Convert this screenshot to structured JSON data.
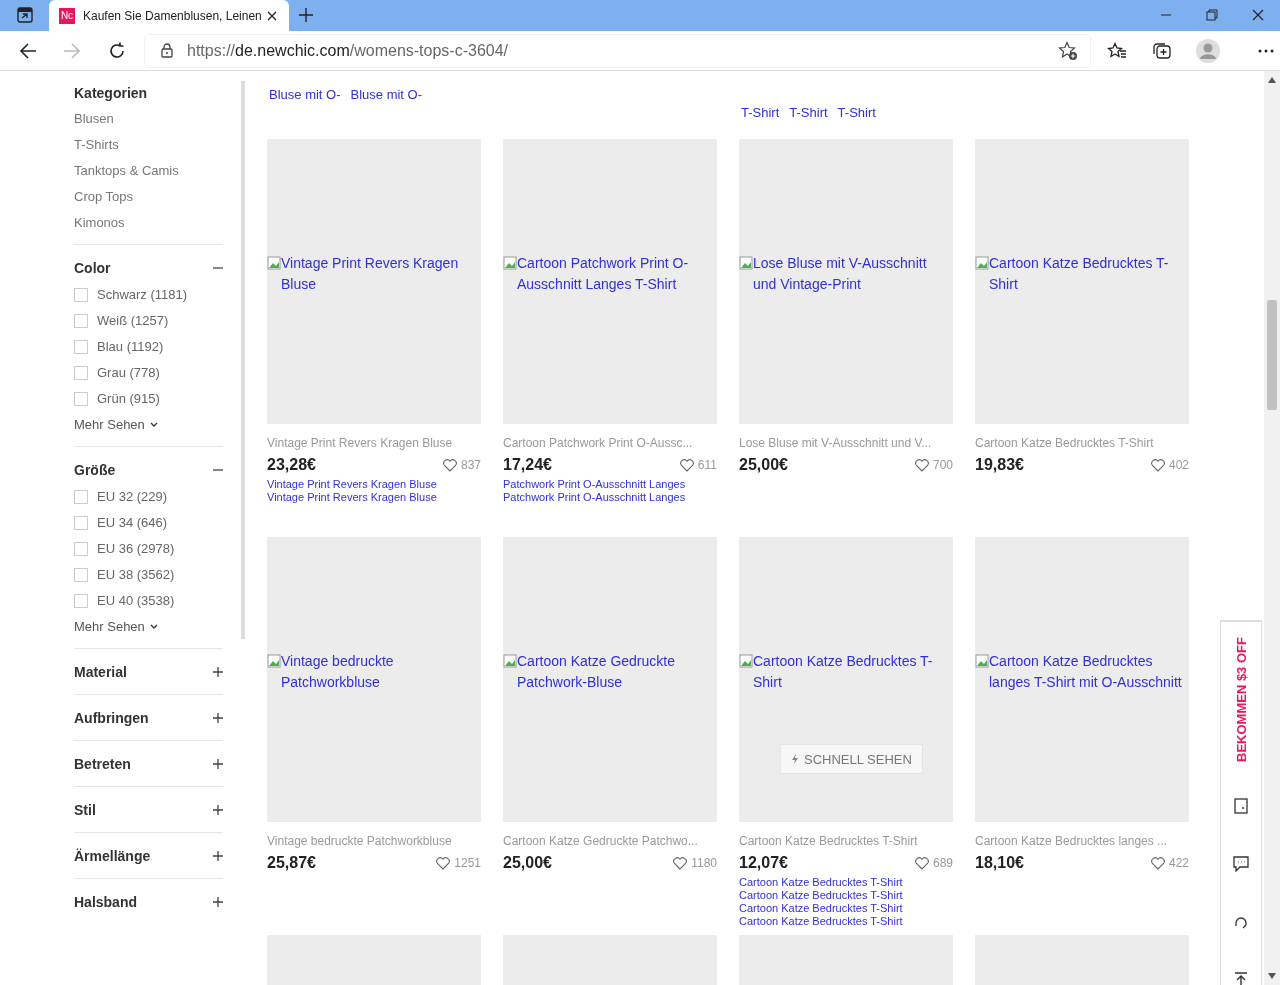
{
  "browser": {
    "favicon": "Nc",
    "tab_title": "Kaufen Sie Damenblusen, Leinen",
    "url_scheme": "https://",
    "url_host": "de.newchic.com",
    "url_path": "/womens-tops-c-3604/"
  },
  "sidebar": {
    "categories": {
      "title": "Kategorien",
      "items": [
        "Blusen",
        "T-Shirts",
        "Tanktops & Camis",
        "Crop Tops",
        "Kimonos"
      ]
    },
    "filters": [
      {
        "title": "Color",
        "expanded": true,
        "options": [
          {
            "label": "Schwarz (1181)",
            "checked": false
          },
          {
            "label": "Weiß (1257)",
            "checked": false
          },
          {
            "label": "Blau (1192)",
            "checked": false
          },
          {
            "label": "Grau (778)",
            "checked": false
          },
          {
            "label": "Grün (915)",
            "checked": false
          }
        ],
        "more": "Mehr Sehen"
      },
      {
        "title": "Größe",
        "expanded": true,
        "options": [
          {
            "label": "EU 32 (229)",
            "checked": false
          },
          {
            "label": "EU 34 (646)",
            "checked": false
          },
          {
            "label": "EU 36 (2978)",
            "checked": false
          },
          {
            "label": "EU 38 (3562)",
            "checked": false
          },
          {
            "label": "EU 40 (3538)",
            "checked": false
          }
        ],
        "more": "Mehr Sehen"
      },
      {
        "title": "Material",
        "expanded": false
      },
      {
        "title": "Aufbringen",
        "expanded": false
      },
      {
        "title": "Betreten",
        "expanded": false
      },
      {
        "title": "Stil",
        "expanded": false
      },
      {
        "title": "Ärmellänge",
        "expanded": false
      },
      {
        "title": "Halsband",
        "expanded": false
      }
    ]
  },
  "top_row": [
    {
      "kind": "thumbs",
      "thumbs": [
        "Bluse mit O-",
        "Bluse mit O-"
      ]
    },
    {
      "kind": "blank"
    },
    {
      "kind": "thumbs",
      "thumbs": [
        "T-Shirt",
        "T-Shirt",
        "T-Shirt"
      ]
    },
    {
      "kind": "blank"
    }
  ],
  "products": [
    {
      "alt": "Vintage Print Revers Kragen Bluse",
      "title": "Vintage Print Revers Kragen Bluse",
      "price": "23,28€",
      "likes": "837",
      "thumbs": [
        "Vintage Print Revers Kragen Bluse",
        "Vintage Print Revers Kragen Bluse"
      ]
    },
    {
      "alt": "Cartoon Patchwork Print O-Ausschnitt Langes T-Shirt",
      "title": "Cartoon Patchwork Print O-Aussc...",
      "price": "17,24€",
      "likes": "611",
      "thumbs": [
        "Patchwork Print O-Ausschnitt Langes",
        "Patchwork Print O-Ausschnitt Langes"
      ]
    },
    {
      "alt": "Lose Bluse mit V-Ausschnitt und Vintage-Print",
      "title": "Lose Bluse mit V-Ausschnitt und V...",
      "price": "25,00€",
      "likes": "700"
    },
    {
      "alt": "Cartoon Katze Bedrucktes T-Shirt",
      "title": "Cartoon Katze Bedrucktes T-Shirt",
      "price": "19,83€",
      "likes": "402"
    },
    {
      "alt": "Vintage bedruckte Patchworkbluse",
      "title": "Vintage bedruckte Patchworkbluse",
      "price": "25,87€",
      "likes": "1251"
    },
    {
      "alt": "Cartoon Katze Gedruckte Patchwork-Bluse",
      "title": "Cartoon Katze Gedruckte Patchwo...",
      "price": "25,00€",
      "likes": "1180"
    },
    {
      "alt": "Cartoon Katze Bedrucktes T-Shirt",
      "title": "Cartoon Katze Bedrucktes T-Shirt",
      "price": "12,07€",
      "likes": "689",
      "thumbs": [
        "Cartoon Katze Bedrucktes T-Shirt",
        "Cartoon Katze Bedrucktes T-Shirt",
        "Cartoon Katze Bedrucktes T-Shirt",
        "Cartoon Katze Bedrucktes T-Shirt"
      ],
      "quick_view": "SCHNELL SEHEN"
    },
    {
      "alt": "Cartoon Katze Bedrucktes langes T-Shirt mit O-Ausschnitt",
      "title": "Cartoon Katze Bedrucktes langes ...",
      "price": "18,10€",
      "likes": "422"
    }
  ],
  "next_row": [
    {
      "kind": "image"
    },
    {
      "kind": "image"
    },
    {
      "kind": "image"
    },
    {
      "kind": "image"
    }
  ],
  "promo": {
    "label": "BEKOMMEN $3 OFF"
  }
}
